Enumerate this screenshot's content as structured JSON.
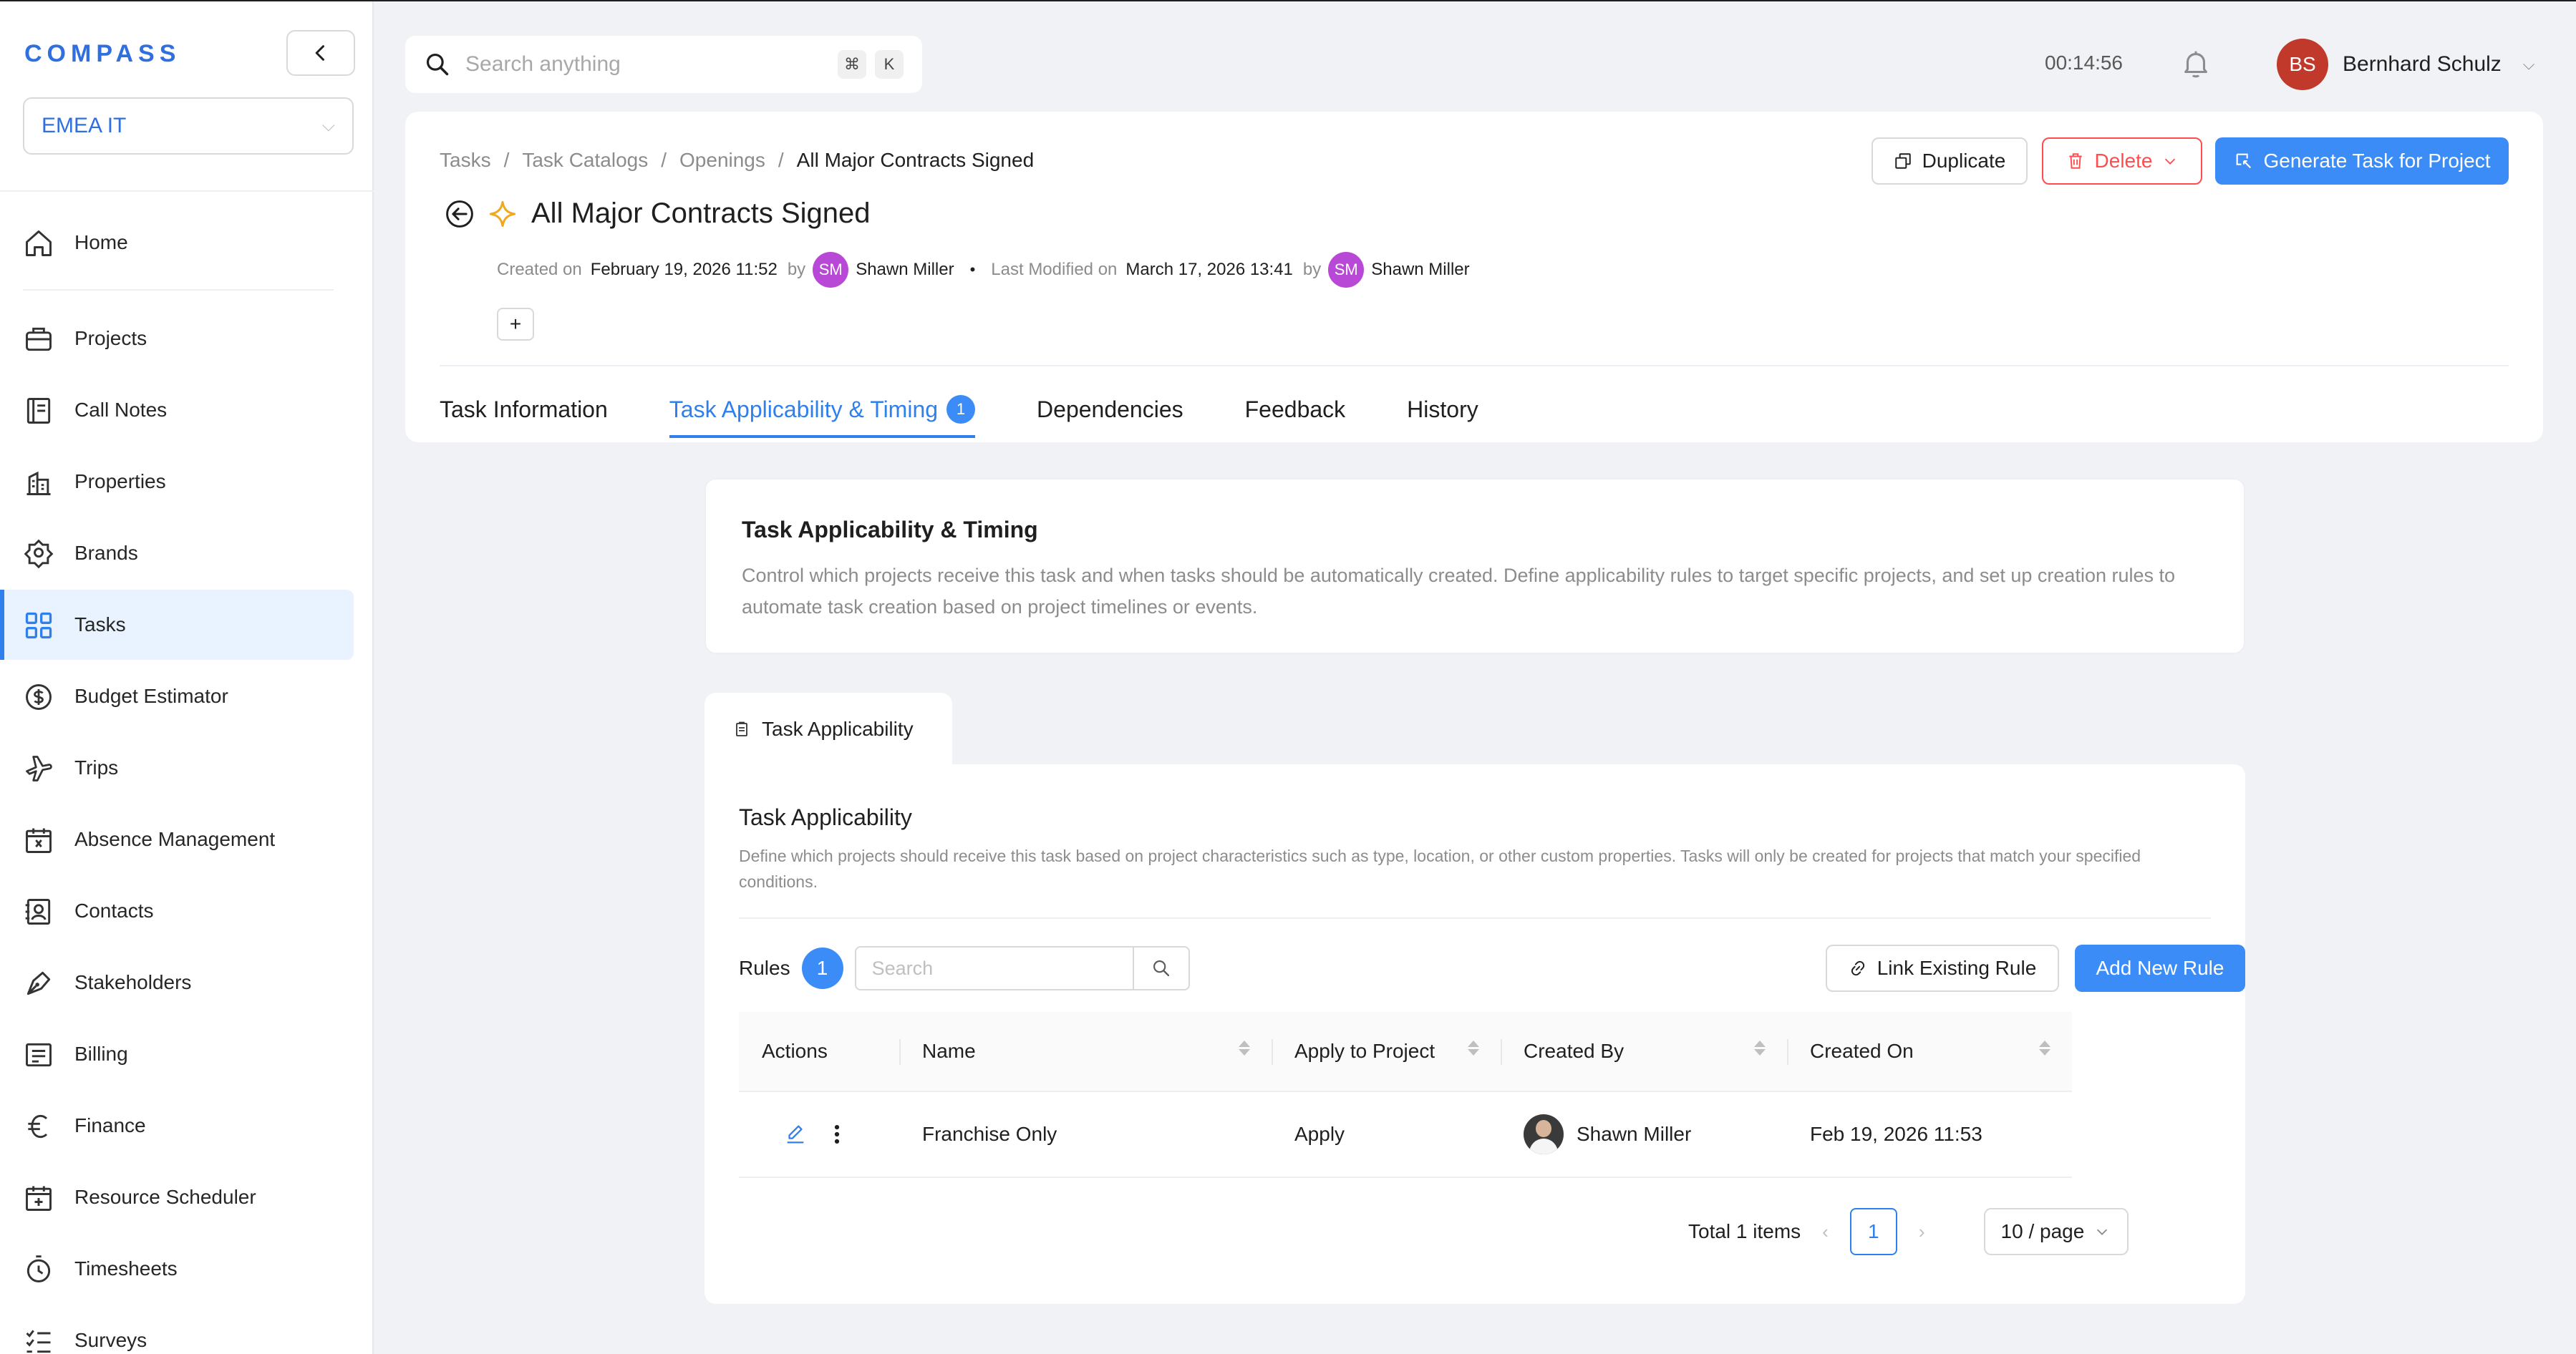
{
  "brand": {
    "logo_text": "COMPASS",
    "accent": "#2f80ed"
  },
  "org_select": {
    "value": "EMEA IT"
  },
  "nav": {
    "items": [
      {
        "label": "Home",
        "icon": "home-icon"
      },
      {
        "label": "Projects",
        "icon": "briefcase-icon"
      },
      {
        "label": "Call Notes",
        "icon": "notebook-icon"
      },
      {
        "label": "Properties",
        "icon": "building-icon"
      },
      {
        "label": "Brands",
        "icon": "badge-icon"
      },
      {
        "label": "Tasks",
        "icon": "grid-icon"
      },
      {
        "label": "Budget Estimator",
        "icon": "dollar-icon"
      },
      {
        "label": "Trips",
        "icon": "plane-icon"
      },
      {
        "label": "Absence Management",
        "icon": "calendar-x-icon"
      },
      {
        "label": "Contacts",
        "icon": "contacts-icon"
      },
      {
        "label": "Stakeholders",
        "icon": "pen-icon"
      },
      {
        "label": "Billing",
        "icon": "billing-icon"
      },
      {
        "label": "Finance",
        "icon": "euro-icon"
      },
      {
        "label": "Resource Scheduler",
        "icon": "calendar-plus-icon"
      },
      {
        "label": "Timesheets",
        "icon": "stopwatch-icon"
      },
      {
        "label": "Surveys",
        "icon": "checklist-icon"
      }
    ],
    "active": "Tasks"
  },
  "topbar": {
    "search_placeholder": "Search anything",
    "shortcut_cmd": "⌘",
    "shortcut_key": "K",
    "timer": "00:14:56",
    "user_initials": "BS",
    "user_name": "Bernhard Schulz"
  },
  "header": {
    "breadcrumb": [
      "Tasks",
      "Task Catalogs",
      "Openings",
      "All Major Contracts Signed"
    ],
    "title": "All Major Contracts Signed",
    "created_label": "Created on",
    "created_date": "February 19, 2026 11:52",
    "by_label": "by",
    "created_by_initials": "SM",
    "created_by": "Shawn Miller",
    "modified_label": "Last Modified on",
    "modified_date": "March 17, 2026 13:41",
    "modified_by_initials": "SM",
    "modified_by": "Shawn Miller",
    "plus": "+",
    "buttons": {
      "duplicate": "Duplicate",
      "delete": "Delete",
      "generate": "Generate Task for Project"
    },
    "tabs": [
      {
        "label": "Task Information"
      },
      {
        "label": "Task Applicability & Timing",
        "badge": "1"
      },
      {
        "label": "Dependencies"
      },
      {
        "label": "Feedback"
      },
      {
        "label": "History"
      }
    ]
  },
  "intro": {
    "title": "Task Applicability & Timing",
    "description": "Control which projects receive this task and when tasks should be automatically created. Define applicability rules to target specific projects, and set up creation rules to automate task creation based on project timelines or events."
  },
  "applicability": {
    "tab_label": "Task Applicability",
    "title": "Task Applicability",
    "description": "Define which projects should receive this task based on project characteristics such as type, location, or other custom properties. Tasks will only be created for projects that match your specified conditions.",
    "rules_label": "Rules",
    "rules_count": "1",
    "search_placeholder": "Search",
    "link_rule": "Link Existing Rule",
    "add_rule": "Add New Rule",
    "columns": [
      "Actions",
      "Name",
      "Apply to Project",
      "Created By",
      "Created On"
    ],
    "rows": [
      {
        "name": "Franchise Only",
        "apply": "Apply",
        "created_by": "Shawn Miller",
        "created_on": "Feb 19, 2026 11:53"
      }
    ],
    "pagination": {
      "total": "Total 1 items",
      "page": "1",
      "page_size": "10 / page"
    }
  }
}
